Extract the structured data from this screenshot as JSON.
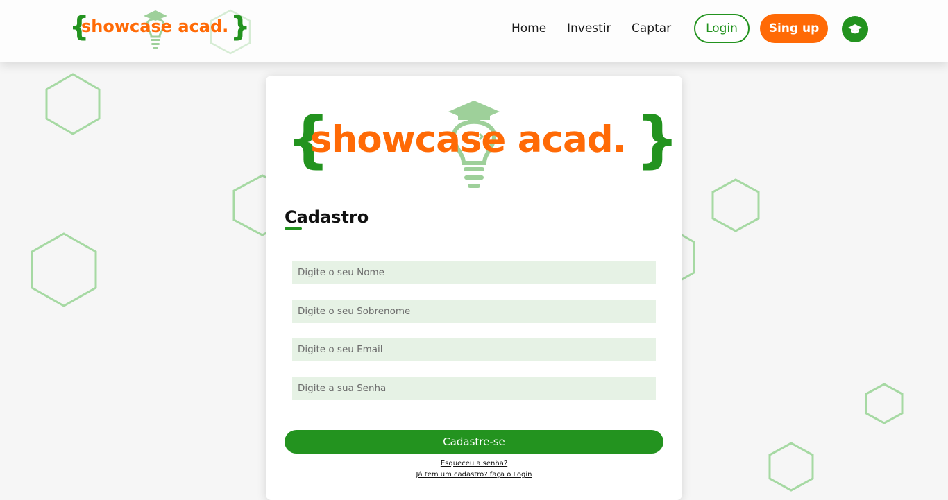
{
  "brand": {
    "name": "showcase acad.",
    "open_brace": "{",
    "close_brace": "}",
    "primary_color": "#ff6a06",
    "accent_color": "#23931f"
  },
  "nav": {
    "links": [
      "Home",
      "Investir",
      "Captar"
    ],
    "login_label": "Login",
    "signup_label": "Sing up",
    "profile_icon": "graduation-cap-icon"
  },
  "form": {
    "title": "Cadastro",
    "fields": [
      {
        "placeholder": "Digite o seu Nome",
        "value": ""
      },
      {
        "placeholder": "Digite o seu Sobrenome",
        "value": ""
      },
      {
        "placeholder": "Digite o seu Email",
        "value": ""
      },
      {
        "placeholder": "Digite a sua Senha",
        "value": ""
      }
    ],
    "submit_label": "Cadastre-se",
    "forgot_password": "Esqueceu a senha?",
    "login_link": "Já tem um cadastro? faça o Login"
  }
}
